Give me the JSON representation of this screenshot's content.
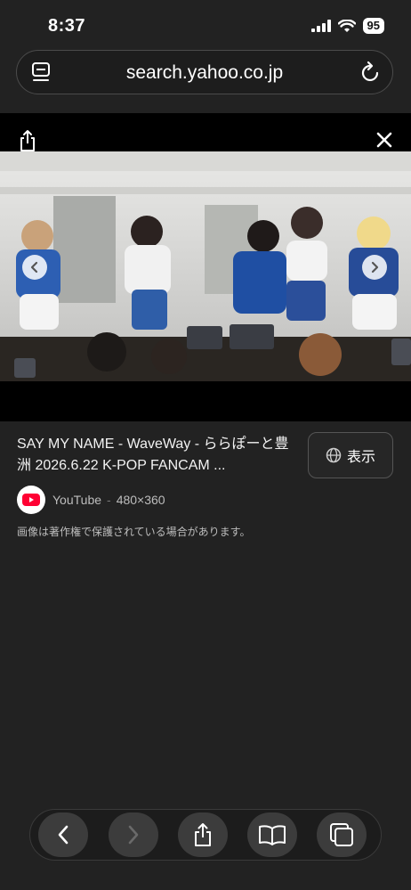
{
  "status": {
    "time": "8:37",
    "battery": "95"
  },
  "browser": {
    "url": "search.yahoo.co.jp"
  },
  "result": {
    "title": "SAY MY NAME - WaveWay - ららぽーと豊洲 2026.6.22 K-POP FANCAM ...",
    "view_label": "表示",
    "source": "YouTube",
    "separator": "-",
    "dimensions": "480×360",
    "copyright_notice": "画像は著作権で保護されている場合があります。"
  },
  "colors": {
    "background": "#222222",
    "youtube_red": "#ff0033"
  },
  "icons": [
    "tabs-icon",
    "reload-icon",
    "share-icon",
    "close-icon",
    "chevron-left-icon",
    "chevron-right-icon",
    "globe-icon",
    "youtube-icon",
    "back-icon",
    "forward-icon",
    "bookmarks-icon",
    "tab-switcher-icon"
  ]
}
